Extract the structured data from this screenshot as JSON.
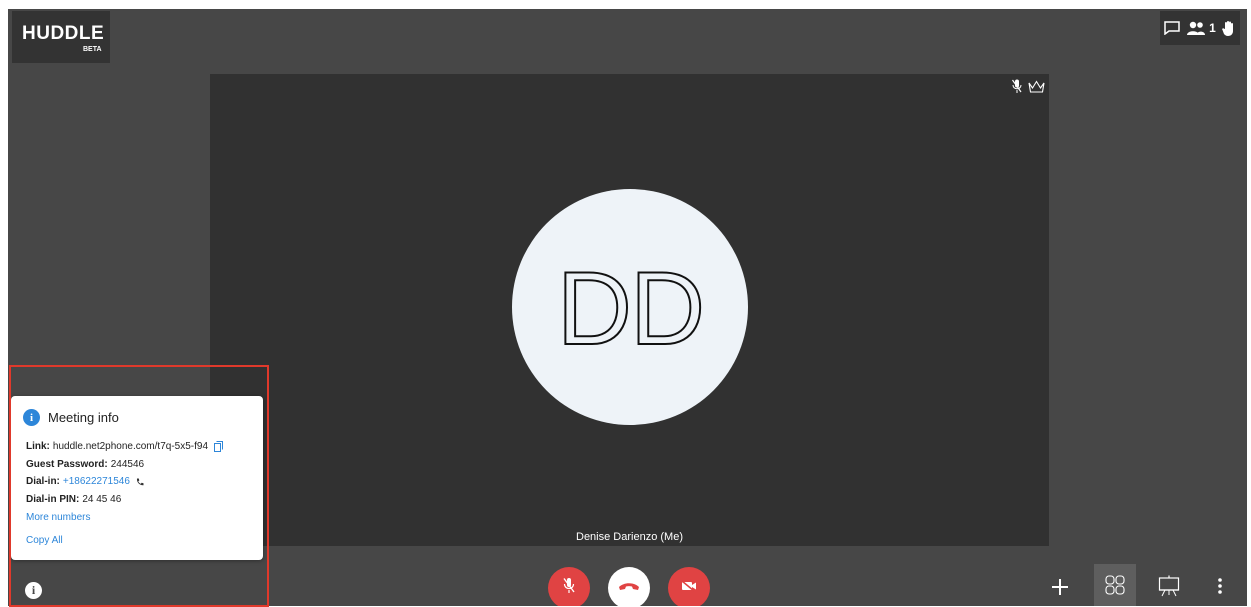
{
  "brand": {
    "name": "HUDDLE",
    "tag": "BETA"
  },
  "top_bar": {
    "participants_count": "1",
    "icons": [
      "chat-icon",
      "participants-icon",
      "raise-hand-icon"
    ]
  },
  "tile": {
    "avatar_initials": "DD",
    "participant_name": "Denise Darienzo (Me)",
    "icons": [
      "mic-muted-icon",
      "moderator-crown-icon"
    ]
  },
  "meeting_info": {
    "title": "Meeting info",
    "link_label": "Link:",
    "link_value": "huddle.net2phone.com/t7q-5x5-f94",
    "password_label": "Guest Password:",
    "password_value": "244546",
    "dialin_label": "Dial-in:",
    "dialin_value": "+18622271546",
    "pin_label": "Dial-in PIN:",
    "pin_value": "24 45 46",
    "more_numbers": "More numbers",
    "copy_all": "Copy All"
  },
  "controls": {
    "left": [
      "info-icon"
    ],
    "center": [
      "mute-mic-button",
      "hang-up-button",
      "camera-off-button"
    ],
    "right": [
      "add-button",
      "tile-layout-button",
      "presentation-button",
      "more-options-button"
    ]
  },
  "colors": {
    "accent": "#2d86d9",
    "danger": "#e04343",
    "background": "#474747",
    "stage": "#313131",
    "highlight": "#e0392b"
  }
}
